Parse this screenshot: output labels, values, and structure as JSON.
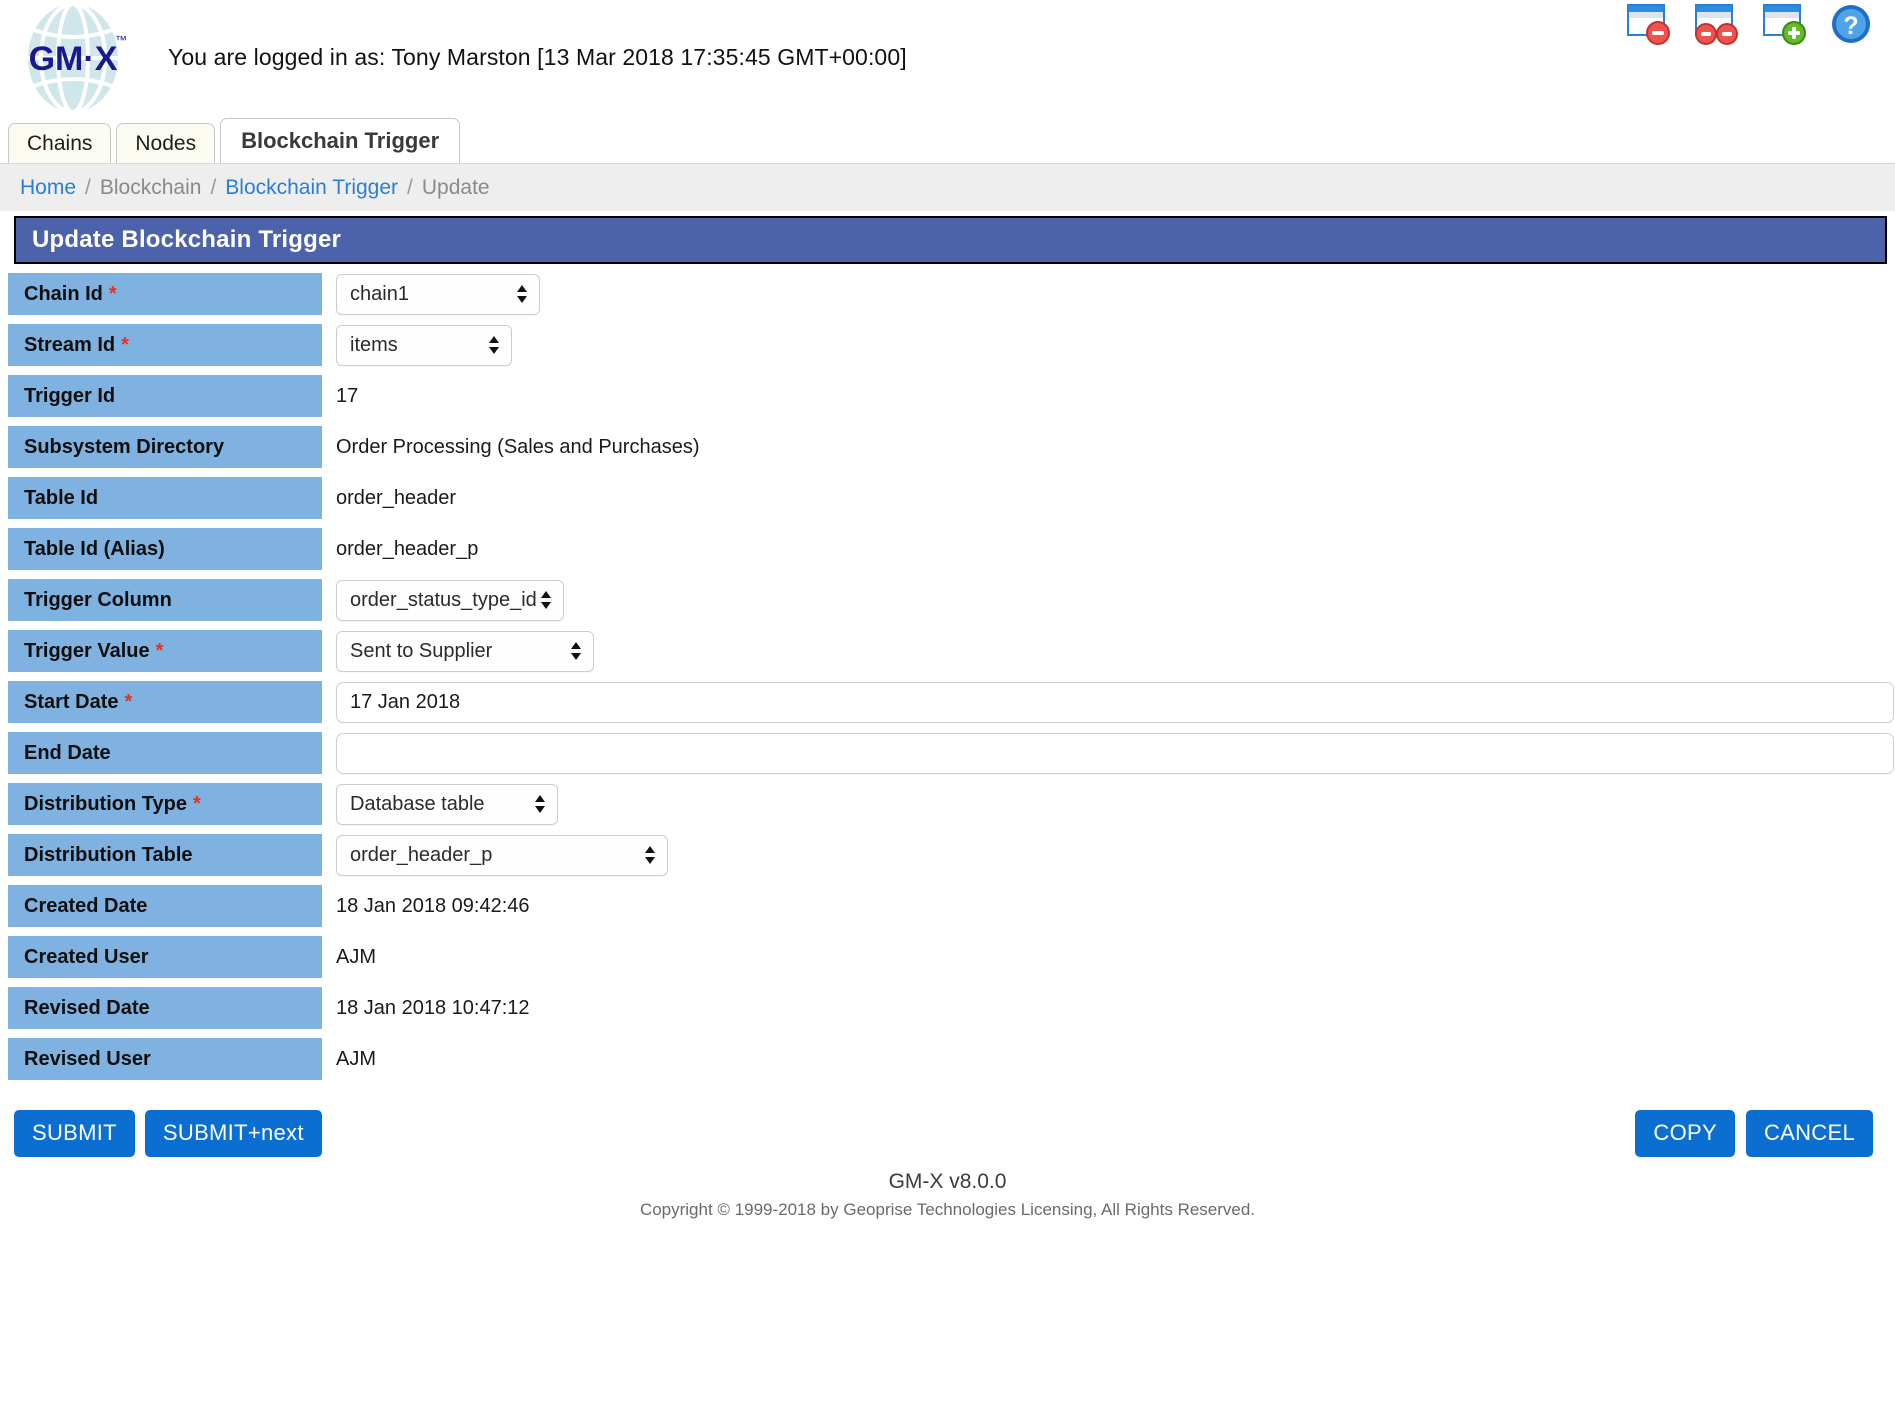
{
  "header": {
    "logo_text": "GM-X",
    "logo_tm": "™",
    "login_status": "You are logged in as: Tony Marston [13 Mar 2018 17:35:45 GMT+00:00]",
    "window_icons": [
      {
        "name": "close-window-icon",
        "title": "Close this window"
      },
      {
        "name": "close-all-windows-icon",
        "title": "Close all windows"
      },
      {
        "name": "new-window-icon",
        "title": "Open new window"
      },
      {
        "name": "help-icon",
        "title": "Help"
      }
    ]
  },
  "tabs": [
    {
      "label": "Chains",
      "active": false
    },
    {
      "label": "Nodes",
      "active": false
    },
    {
      "label": "Blockchain Trigger",
      "active": true
    }
  ],
  "breadcrumb": {
    "separator": "/",
    "items": [
      {
        "label": "Home",
        "link": true
      },
      {
        "label": "Blockchain",
        "link": false
      },
      {
        "label": "Blockchain Trigger",
        "link": true
      },
      {
        "label": "Update",
        "link": false
      }
    ]
  },
  "panel": {
    "title": "Update Blockchain Trigger"
  },
  "fields": [
    {
      "label": "Chain Id",
      "required": true,
      "type": "select",
      "value": "chain1"
    },
    {
      "label": "Stream Id",
      "required": true,
      "type": "select",
      "value": "items"
    },
    {
      "label": "Trigger Id",
      "required": false,
      "type": "static",
      "value": "17"
    },
    {
      "label": "Subsystem Directory",
      "required": false,
      "type": "static",
      "value": "Order Processing (Sales and Purchases)"
    },
    {
      "label": "Table Id",
      "required": false,
      "type": "static",
      "value": "order_header"
    },
    {
      "label": "Table Id (Alias)",
      "required": false,
      "type": "static",
      "value": "order_header_p"
    },
    {
      "label": "Trigger Column",
      "required": false,
      "type": "select",
      "value": "order_status_type_id"
    },
    {
      "label": "Trigger Value",
      "required": true,
      "type": "select",
      "value": "Sent to Supplier"
    },
    {
      "label": "Start Date",
      "required": true,
      "type": "text",
      "value": "17 Jan 2018",
      "placeholder": ""
    },
    {
      "label": "End Date",
      "required": false,
      "type": "text",
      "value": "",
      "placeholder": ""
    },
    {
      "label": "Distribution Type",
      "required": true,
      "type": "select",
      "value": "Database table"
    },
    {
      "label": "Distribution Table",
      "required": false,
      "type": "select",
      "value": "order_header_p"
    },
    {
      "label": "Created Date",
      "required": false,
      "type": "static",
      "value": "18 Jan 2018 09:42:46"
    },
    {
      "label": "Created User",
      "required": false,
      "type": "static",
      "value": "AJM"
    },
    {
      "label": "Revised Date",
      "required": false,
      "type": "static",
      "value": "18 Jan 2018 10:47:12"
    },
    {
      "label": "Revised User",
      "required": false,
      "type": "static",
      "value": "AJM"
    }
  ],
  "actions": {
    "submit": "SUBMIT",
    "submit_next": "SUBMIT+next",
    "copy": "COPY",
    "cancel": "CANCEL"
  },
  "footer": {
    "version": "GM-X v8.0.0",
    "copyright": "Copyright © 1999-2018 by Geoprise Technologies Licensing, All Rights Reserved."
  },
  "colors": {
    "panel_header": "#4c62ab",
    "label_cell": "#7fb2e0",
    "button": "#0a6fd1",
    "link": "#2a7fd4",
    "required_star": "#e8301e",
    "breadcrumb_bg": "#eeeeee"
  }
}
